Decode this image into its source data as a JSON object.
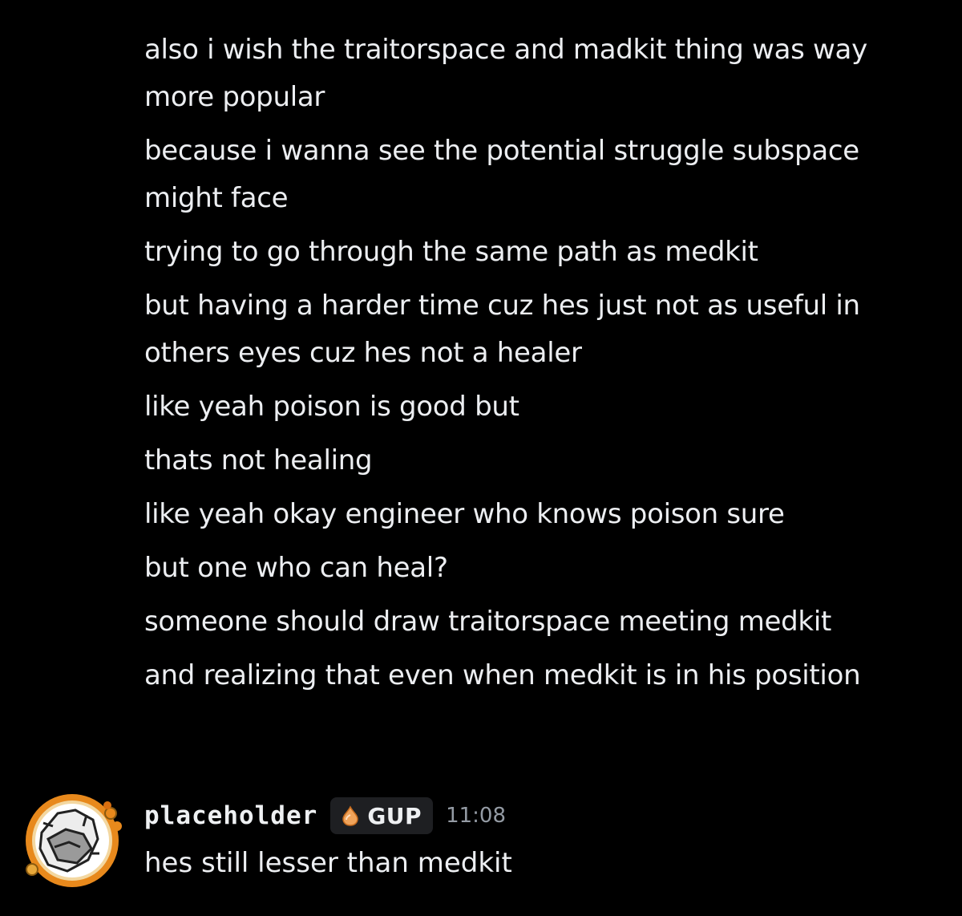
{
  "messages": [
    {
      "text": "also i wish the traitorspace and madkit thing was way more popular"
    },
    {
      "text": "because i wanna see the potential struggle subspace might face"
    },
    {
      "text": "trying to go through the same path as medkit"
    },
    {
      "text": "but having a harder time cuz hes just not as useful in others eyes cuz hes not a healer"
    },
    {
      "text": "like yeah poison is good but"
    },
    {
      "text": "thats not healing"
    },
    {
      "text": "like yeah okay engineer who knows poison sure"
    },
    {
      "text": "but one who can heal?"
    },
    {
      "text": "someone should draw traitorspace meeting medkit"
    },
    {
      "text": "and realizing that even when medkit is in his position"
    }
  ],
  "next_message": {
    "username": "placeholder",
    "tag": "GUP",
    "timestamp": "11:08",
    "text": "hes still lesser than medkit",
    "avatar_icon": "avatar-image",
    "tag_icon": "orange-drop-icon",
    "colors": {
      "background": "#000000",
      "text": "#eceef1",
      "timestamp": "#949ba4",
      "tag_bg": "#1e1f22",
      "avatar_ring": "#e8891c"
    }
  }
}
